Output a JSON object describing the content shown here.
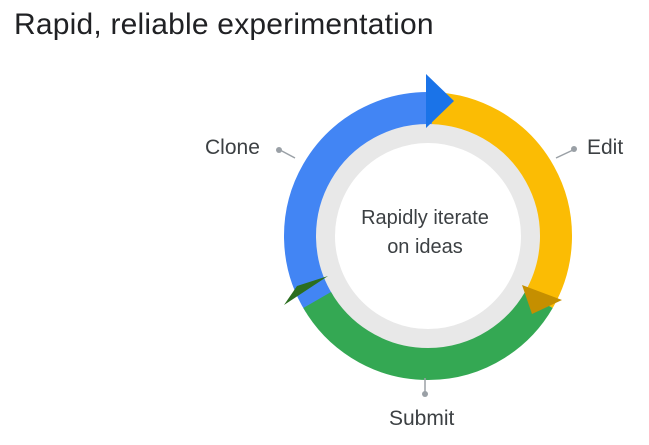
{
  "title": "Rapid, reliable experimentation",
  "cycle": {
    "center_line1": "Rapidly iterate",
    "center_line2": "on ideas",
    "steps": [
      {
        "label": "Clone",
        "color": "#4285f4",
        "arrow_color": "#1a73e8"
      },
      {
        "label": "Edit",
        "color": "#fbbc04",
        "arrow_color": "#c58f00"
      },
      {
        "label": "Submit",
        "color": "#34a853",
        "arrow_color": "#2b6e1f"
      }
    ],
    "inner_ring_color": "#e8e8e8"
  }
}
